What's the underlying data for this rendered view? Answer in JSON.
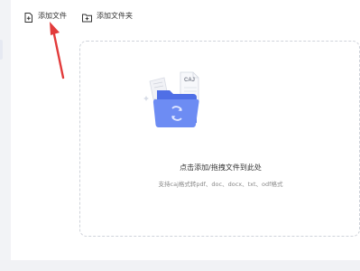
{
  "toolbar": {
    "add_file_label": "添加文件",
    "add_folder_label": "添加文件夹"
  },
  "drop_zone": {
    "title": "点击添加/拖拽文件到此处",
    "subtitle": "支持caj格式转pdf、doc、docx、txt、odf格式",
    "badge_text": "CAJ"
  },
  "colors": {
    "accent": "#5b7ff0",
    "annotation": "#e23b3b"
  },
  "icons": {
    "add_file": "add-file-icon",
    "add_folder": "add-folder-icon",
    "illustration": "caj-folder-illustration"
  }
}
